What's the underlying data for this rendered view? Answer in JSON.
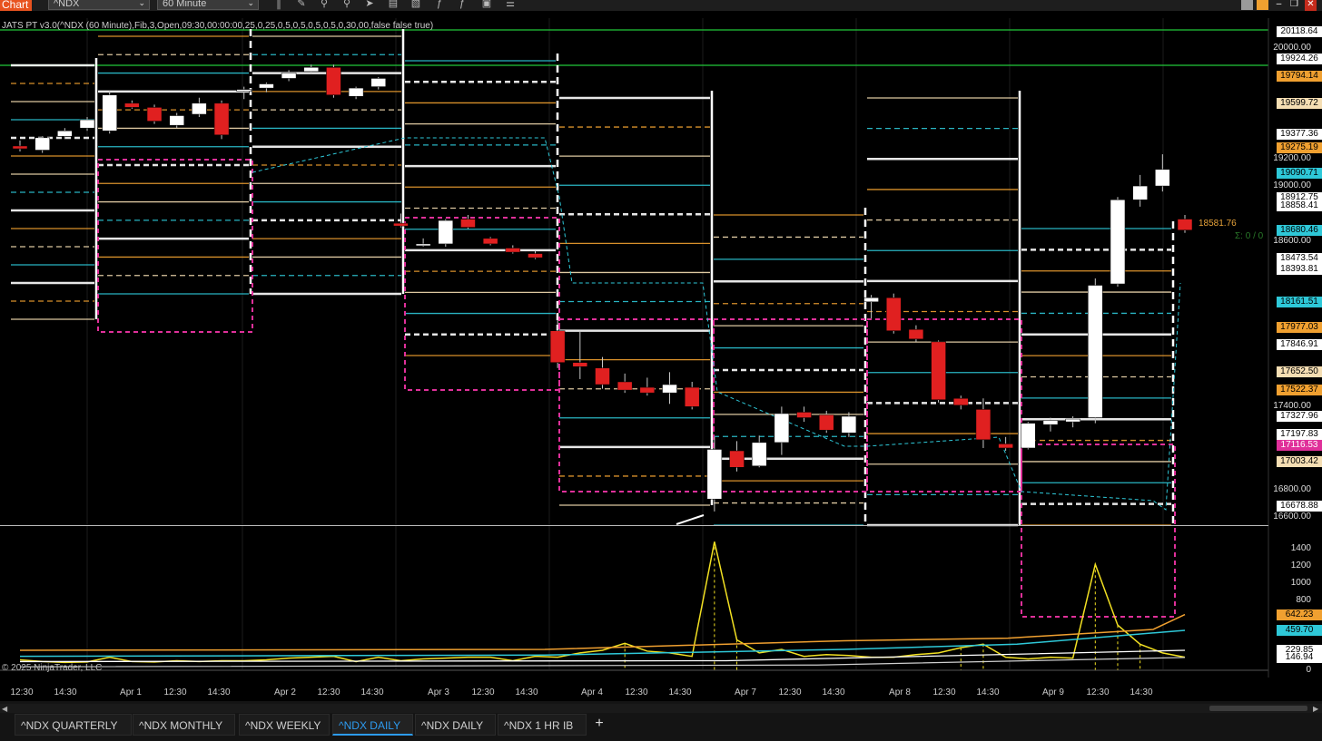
{
  "window": {
    "app_tab": "Chart",
    "instrument": "^NDX",
    "interval": "60 Minute",
    "toolbar_icons": [
      "bar-type-icon",
      "pencil-icon",
      "zoom-in-icon",
      "zoom-out-icon",
      "pointer-icon",
      "data-box-icon",
      "tool-icon",
      "indicator-icon",
      "strategy-icon",
      "properties-icon"
    ],
    "win_controls": [
      "minimize",
      "maximize",
      "close"
    ]
  },
  "indicator_label": "JATS PT v3.0(^NDX (60 Minute),Fib,3,Open,09:30,00:00:00,25,0,25,0,5,0,5,0,5,0,5,0,30,00,false false true)",
  "copyright": "© 2025 NinjaTrader, LLC",
  "price_axis": {
    "ticks": [
      "20000.00",
      "19200.00",
      "19000.00",
      "18600.00",
      "17400.00",
      "16800.00",
      "16600.00"
    ],
    "labels": [
      {
        "text": "20118.64",
        "color": "#ffffff"
      },
      {
        "text": "19924.26",
        "color": "#ffffff"
      },
      {
        "text": "19794.14",
        "color": "#f0a030"
      },
      {
        "text": "19599.72",
        "color": "#f5deb3"
      },
      {
        "text": "19377.36",
        "color": "#ffffff"
      },
      {
        "text": "19275.19",
        "color": "#f0a030"
      },
      {
        "text": "19090.71",
        "color": "#2ec8d8"
      },
      {
        "text": "18912.75",
        "color": "#ffffff"
      },
      {
        "text": "18858.41",
        "color": "#ffffff"
      },
      {
        "text": "18680.46",
        "color": "#2ec8d8"
      },
      {
        "text": "18473.54",
        "color": "#ffffff"
      },
      {
        "text": "18393.81",
        "color": "#ffffff"
      },
      {
        "text": "18161.51",
        "color": "#2ec8d8"
      },
      {
        "text": "17977.03",
        "color": "#f0a030"
      },
      {
        "text": "17846.91",
        "color": "#ffffff"
      },
      {
        "text": "17652.50",
        "color": "#f5deb3"
      },
      {
        "text": "17522.37",
        "color": "#f0a030"
      },
      {
        "text": "17327.96",
        "color": "#ffffff"
      },
      {
        "text": "17197.83",
        "color": "#ffffff"
      },
      {
        "text": "17116.53",
        "color": "#e0309a"
      },
      {
        "text": "17003.42",
        "color": "#f5deb3"
      },
      {
        "text": "16678.88",
        "color": "#ffffff"
      }
    ],
    "current_price": "18581.76",
    "sigma": "Σ: 0 / 0"
  },
  "volume_axis": {
    "ticks": [
      "1400",
      "1200",
      "1000",
      "800",
      "0"
    ],
    "labels": [
      {
        "text": "642.23",
        "color": "#f0a030"
      },
      {
        "text": "459.70",
        "color": "#2ec8d8"
      },
      {
        "text": "229.85",
        "color": "#ffffff"
      },
      {
        "text": "146.94",
        "color": "#ffffff"
      }
    ]
  },
  "time_axis": [
    "12:30",
    "14:30",
    "Apr 1",
    "12:30",
    "14:30",
    "Apr 2",
    "12:30",
    "14:30",
    "Apr 3",
    "12:30",
    "14:30",
    "Apr 4",
    "12:30",
    "14:30",
    "Apr 7",
    "12:30",
    "14:30",
    "Apr 8",
    "12:30",
    "14:30",
    "Apr 9",
    "12:30",
    "14:30"
  ],
  "tabs": [
    {
      "label": "^NDX QUARTERLY",
      "active": false
    },
    {
      "label": "^NDX MONTHLY",
      "active": false
    },
    {
      "label": "^NDX WEEKLY",
      "active": false
    },
    {
      "label": "^NDX DAILY",
      "active": true
    },
    {
      "label": "^NDX DAILY",
      "active": false
    },
    {
      "label": "^NDX 1 HR IB",
      "active": false
    }
  ],
  "add_tab": "+",
  "chart_data": {
    "type": "candlestick",
    "instrument": "^NDX",
    "interval": "60 Minute",
    "ylim": [
      16550,
      20200
    ],
    "grid": true,
    "candles": [
      {
        "o": 19290,
        "h": 19330,
        "l": 19250,
        "c": 19270
      },
      {
        "o": 19260,
        "h": 19360,
        "l": 19240,
        "c": 19350
      },
      {
        "o": 19360,
        "h": 19420,
        "l": 19340,
        "c": 19400
      },
      {
        "o": 19420,
        "h": 19500,
        "l": 19400,
        "c": 19480
      },
      {
        "o": 19400,
        "h": 19690,
        "l": 19380,
        "c": 19660
      },
      {
        "o": 19600,
        "h": 19620,
        "l": 19560,
        "c": 19570
      },
      {
        "o": 19570,
        "h": 19590,
        "l": 19450,
        "c": 19470
      },
      {
        "o": 19440,
        "h": 19530,
        "l": 19420,
        "c": 19510
      },
      {
        "o": 19520,
        "h": 19640,
        "l": 19500,
        "c": 19600
      },
      {
        "o": 19600,
        "h": 19620,
        "l": 19340,
        "c": 19370
      },
      {
        "o": 19690,
        "h": 19720,
        "l": 19630,
        "c": 19700
      },
      {
        "o": 19710,
        "h": 19750,
        "l": 19680,
        "c": 19740
      },
      {
        "o": 19780,
        "h": 19840,
        "l": 19760,
        "c": 19820
      },
      {
        "o": 19830,
        "h": 19880,
        "l": 19810,
        "c": 19860
      },
      {
        "o": 19860,
        "h": 19880,
        "l": 19640,
        "c": 19660
      },
      {
        "o": 19650,
        "h": 19720,
        "l": 19630,
        "c": 19710
      },
      {
        "o": 19720,
        "h": 19790,
        "l": 19700,
        "c": 19780
      },
      {
        "o": 18730,
        "h": 18800,
        "l": 18700,
        "c": 18710
      },
      {
        "o": 18580,
        "h": 18620,
        "l": 18560,
        "c": 18580
      },
      {
        "o": 18580,
        "h": 18760,
        "l": 18560,
        "c": 18750
      },
      {
        "o": 18760,
        "h": 18790,
        "l": 18690,
        "c": 18700
      },
      {
        "o": 18620,
        "h": 18630,
        "l": 18570,
        "c": 18580
      },
      {
        "o": 18550,
        "h": 18570,
        "l": 18510,
        "c": 18520
      },
      {
        "o": 18510,
        "h": 18530,
        "l": 18470,
        "c": 18480
      },
      {
        "o": 17950,
        "h": 18030,
        "l": 17680,
        "c": 17720
      },
      {
        "o": 17720,
        "h": 17950,
        "l": 17600,
        "c": 17690
      },
      {
        "o": 17680,
        "h": 17760,
        "l": 17530,
        "c": 17560
      },
      {
        "o": 17580,
        "h": 17640,
        "l": 17500,
        "c": 17520
      },
      {
        "o": 17540,
        "h": 17610,
        "l": 17480,
        "c": 17500
      },
      {
        "o": 17500,
        "h": 17650,
        "l": 17420,
        "c": 17560
      },
      {
        "o": 17540,
        "h": 17580,
        "l": 17380,
        "c": 17400
      },
      {
        "o": 16730,
        "h": 17180,
        "l": 16640,
        "c": 17090
      },
      {
        "o": 17080,
        "h": 17150,
        "l": 16930,
        "c": 16960
      },
      {
        "o": 16970,
        "h": 17190,
        "l": 16960,
        "c": 17140
      },
      {
        "o": 17140,
        "h": 17400,
        "l": 17050,
        "c": 17350
      },
      {
        "o": 17360,
        "h": 17400,
        "l": 17290,
        "c": 17320
      },
      {
        "o": 17340,
        "h": 17370,
        "l": 17210,
        "c": 17230
      },
      {
        "o": 17210,
        "h": 17360,
        "l": 17180,
        "c": 17330
      },
      {
        "o": 18160,
        "h": 18210,
        "l": 18040,
        "c": 18190
      },
      {
        "o": 18190,
        "h": 18220,
        "l": 17930,
        "c": 17950
      },
      {
        "o": 17960,
        "h": 17990,
        "l": 17870,
        "c": 17890
      },
      {
        "o": 17870,
        "h": 17880,
        "l": 17430,
        "c": 17450
      },
      {
        "o": 17460,
        "h": 17480,
        "l": 17380,
        "c": 17410
      },
      {
        "o": 17380,
        "h": 17460,
        "l": 17100,
        "c": 17160
      },
      {
        "o": 17130,
        "h": 17180,
        "l": 17080,
        "c": 17100
      },
      {
        "o": 17100,
        "h": 17290,
        "l": 17090,
        "c": 17280
      },
      {
        "o": 17270,
        "h": 17320,
        "l": 17220,
        "c": 17300
      },
      {
        "o": 17290,
        "h": 17330,
        "l": 17250,
        "c": 17310
      },
      {
        "o": 17320,
        "h": 18330,
        "l": 17280,
        "c": 18280
      },
      {
        "o": 18290,
        "h": 18920,
        "l": 18270,
        "c": 18900
      },
      {
        "o": 18900,
        "h": 19080,
        "l": 18850,
        "c": 19000
      },
      {
        "o": 19000,
        "h": 19230,
        "l": 18960,
        "c": 19120
      },
      {
        "o": 18760,
        "h": 18790,
        "l": 18660,
        "c": 18680
      }
    ],
    "volume": [
      120,
      100,
      90,
      95,
      150,
      100,
      95,
      110,
      100,
      110,
      110,
      120,
      140,
      150,
      160,
      100,
      150,
      110,
      130,
      140,
      150,
      150,
      110,
      160,
      150,
      200,
      230,
      310,
      220,
      200,
      160,
      1480,
      350,
      200,
      240,
      160,
      180,
      170,
      150,
      150,
      180,
      200,
      260,
      300,
      150,
      130,
      150,
      140,
      1220,
      520,
      300,
      200,
      150
    ]
  }
}
